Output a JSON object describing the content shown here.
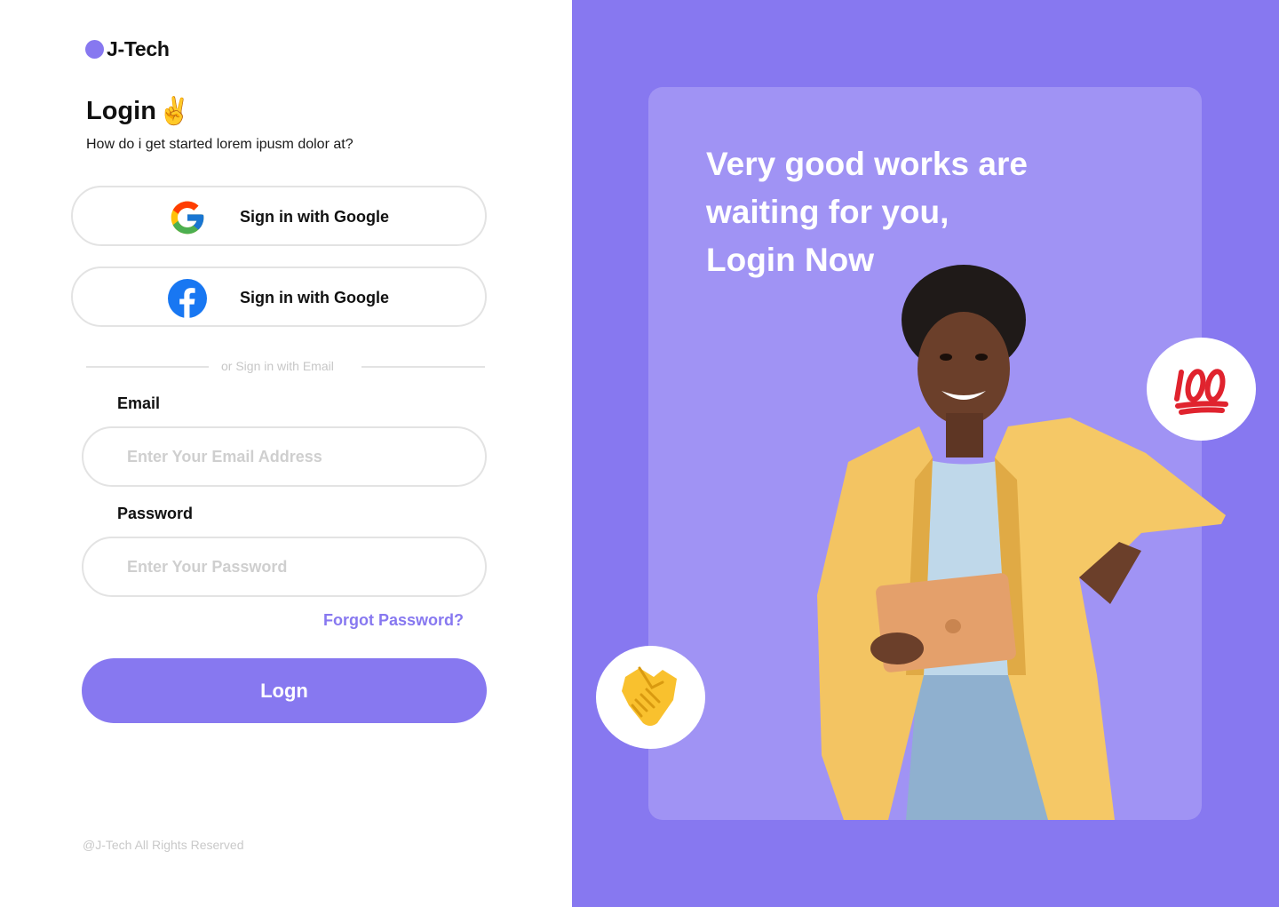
{
  "brand": {
    "name": "J-Tech",
    "accent": "#8778F0"
  },
  "login": {
    "title": "Login",
    "title_emoji": "✌️",
    "subtitle": "How do i get started lorem ipusm dolor at?",
    "google_button": {
      "label": "Sign in with Google",
      "icon": "google-icon"
    },
    "facebook_button": {
      "label": "Sign in with Google",
      "icon": "facebook-icon"
    },
    "divider_text": "or Sign in with Email",
    "email": {
      "label": "Email",
      "placeholder": "Enter Your Email Address",
      "value": ""
    },
    "password": {
      "label": "Password",
      "placeholder": "Enter Your Password",
      "value": ""
    },
    "forgot_link": "Forgot Password?",
    "submit_label": "Logn"
  },
  "footer": {
    "text": "@J-Tech All Rights Reserved"
  },
  "hero": {
    "line1": "Very good works are",
    "line2": "waiting for you,",
    "line3": "Login Now",
    "badge_top": "hundred-points-emoji",
    "badge_bottom": "handshake-emoji",
    "background": "#8778F0",
    "card_color": "#A093F4"
  }
}
